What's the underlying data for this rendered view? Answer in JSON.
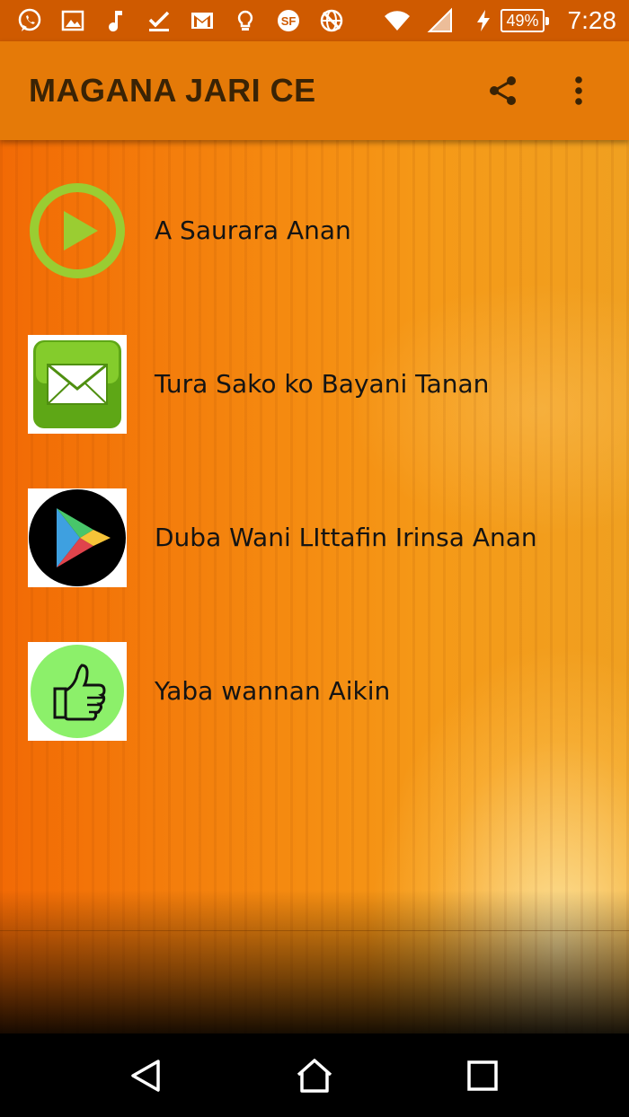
{
  "status_bar": {
    "left_icons": [
      "whatsapp-icon",
      "image-icon",
      "music-note-icon",
      "download-done-icon",
      "gmail-icon",
      "lightbulb-icon",
      "sf-app-icon",
      "globe-blocked-icon"
    ],
    "battery_text": "49%",
    "time": "7:28"
  },
  "toolbar": {
    "title": "MAGANA JARI CE",
    "share_icon": "share-icon",
    "overflow_icon": "more-vert-icon"
  },
  "menu": {
    "items": [
      {
        "label": "A Saurara Anan",
        "icon": "play-circle-icon"
      },
      {
        "label": "Tura Sako ko Bayani Tanan",
        "icon": "envelope-icon"
      },
      {
        "label": "Duba Wani LIttafin Irinsa Anan",
        "icon": "play-store-icon"
      },
      {
        "label": "Yaba wannan Aikin",
        "icon": "thumbs-up-icon"
      }
    ]
  },
  "colors": {
    "status_bar": "#cf5a00",
    "toolbar": "#e57a08",
    "title_text": "#3a2305",
    "play_green": "#9acd32",
    "envelope_green": "#6cb51e",
    "thumb_green": "#8cf06a"
  },
  "nav_bar": {
    "back_icon": "back-triangle-icon",
    "home_icon": "home-icon",
    "recents_icon": "recents-square-icon"
  }
}
